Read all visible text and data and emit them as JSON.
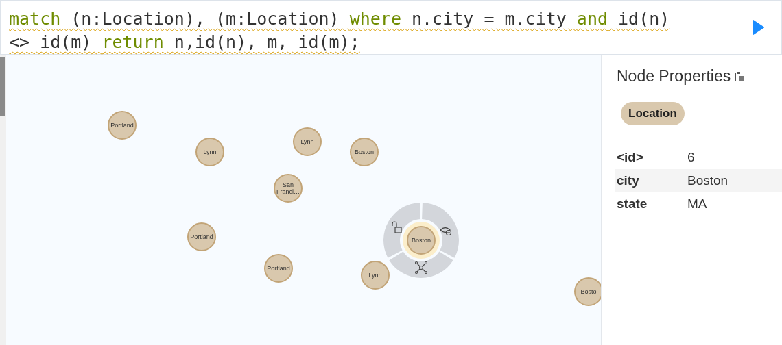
{
  "query": {
    "lines": [
      [
        {
          "text": "match",
          "kind": "keyword"
        },
        {
          "text": " (n:Location), (m:Location) ",
          "kind": "plain"
        },
        {
          "text": "where",
          "kind": "keyword"
        },
        {
          "text": " n.city = m.city ",
          "kind": "plain"
        },
        {
          "text": "and",
          "kind": "keyword"
        },
        {
          "text": " id(n)",
          "kind": "plain"
        }
      ],
      [
        {
          "text": "<> id(m) ",
          "kind": "plain"
        },
        {
          "text": "return",
          "kind": "keyword"
        },
        {
          "text": " n,id(n), m, id(m);",
          "kind": "plain"
        }
      ]
    ]
  },
  "graph": {
    "nodes": [
      {
        "label": "Portland",
        "selected": false
      },
      {
        "label": "Lynn",
        "selected": false
      },
      {
        "label": "Lynn",
        "selected": false
      },
      {
        "label": "Boston",
        "selected": false
      },
      {
        "label": "San Franci…",
        "selected": false
      },
      {
        "label": "Portland",
        "selected": false
      },
      {
        "label": "Portland",
        "selected": false
      },
      {
        "label": "Lynn",
        "selected": false
      },
      {
        "label": "Boston",
        "selected": true
      },
      {
        "label": "Bosto",
        "selected": false
      }
    ]
  },
  "panel": {
    "title": "Node Properties",
    "label": "Location",
    "properties": [
      {
        "key": "<id>",
        "value": "6"
      },
      {
        "key": "city",
        "value": "Boston"
      },
      {
        "key": "state",
        "value": "MA"
      }
    ]
  }
}
